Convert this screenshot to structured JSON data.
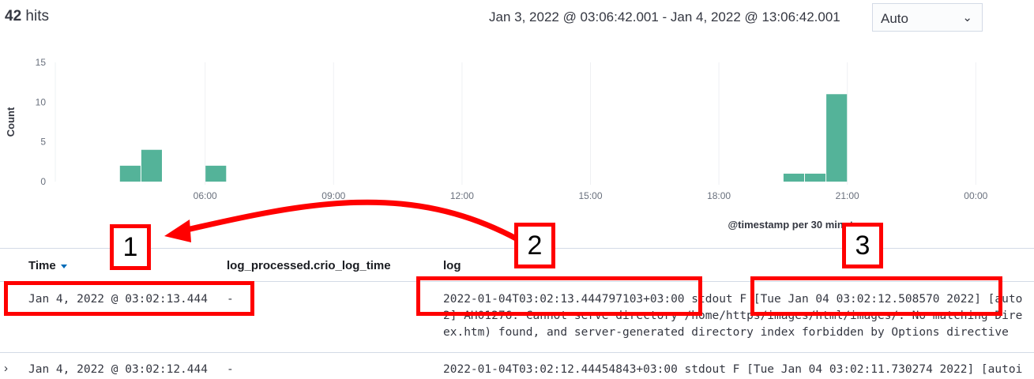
{
  "header": {
    "hits_count": "42",
    "hits_label": "hits",
    "date_range": "Jan 3, 2022 @ 03:06:42.001 - Jan 4, 2022 @ 13:06:42.001",
    "interval_select": {
      "selected": "Auto"
    }
  },
  "chart_data": {
    "type": "bar",
    "ylabel": "Count",
    "xlabel": "@timestamp per 30 minutes",
    "ylim": [
      0,
      15
    ],
    "yticks": [
      "15",
      "10",
      "5",
      "0"
    ],
    "xtick_labels": [
      "06:00",
      "09:00",
      "12:00",
      "15:00",
      "18:00",
      "21:00",
      "00:00"
    ],
    "bars": [
      {
        "time": "04:00",
        "count": 2
      },
      {
        "time": "04:30",
        "count": 4
      },
      {
        "time": "06:00",
        "count": 2
      },
      {
        "time": "19:30",
        "count": 1
      },
      {
        "time": "20:00",
        "count": 1
      },
      {
        "time": "20:30",
        "count": 11
      }
    ],
    "bar_color": "#54b399",
    "grid": "vertical"
  },
  "table": {
    "columns": {
      "time": "Time",
      "crio": "log_processed.crio_log_time",
      "log": "log"
    },
    "rows": [
      {
        "time": "Jan 4, 2022 @ 03:02:13.444",
        "crio": "-",
        "log_lines": [
          "2022-01-04T03:02:13.444797103+03:00 stdout F [Tue Jan 04 03:02:12.508570 2022] [auto",
          "2] AH01276: Cannot serve directory /home/https/images/html/images/: No matching Dire",
          "ex.htm) found, and server-generated directory index forbidden by Options directive"
        ]
      },
      {
        "time": "Jan 4, 2022 @ 03:02:12.444",
        "crio": "-",
        "log_lines": [
          "2022-01-04T03:02:12.44454843+03:00 stdout F [Tue Jan 04 03:02:11.730274 2022] [autoi"
        ]
      }
    ]
  },
  "annotations": {
    "label1": "1",
    "label2": "2",
    "label3": "3",
    "color": "#ff0000"
  }
}
